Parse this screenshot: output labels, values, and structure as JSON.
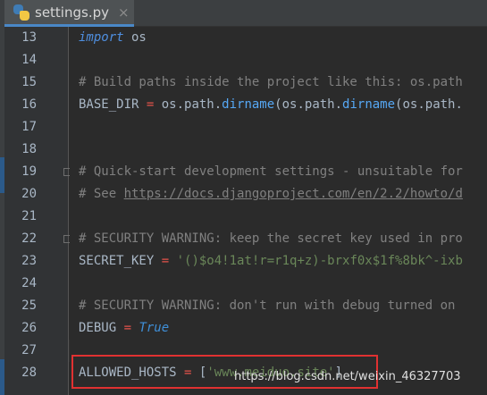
{
  "tab": {
    "filename": "settings.py",
    "close_glyph": "×",
    "icon": "python-file-icon"
  },
  "lines": [
    {
      "num": "13",
      "tokens": [
        {
          "t": "import",
          "c": "kw-imp"
        },
        {
          "t": " os",
          "c": "plain"
        }
      ]
    },
    {
      "num": "14",
      "tokens": []
    },
    {
      "num": "15",
      "tokens": [
        {
          "t": "# Build paths inside the project like this: os.path",
          "c": "cmt"
        }
      ]
    },
    {
      "num": "16",
      "tokens": [
        {
          "t": "BASE_DIR ",
          "c": "plain"
        },
        {
          "t": "=",
          "c": "op"
        },
        {
          "t": " os.path.",
          "c": "plain"
        },
        {
          "t": "dirname",
          "c": "call"
        },
        {
          "t": "(os.path.",
          "c": "plain"
        },
        {
          "t": "dirname",
          "c": "call"
        },
        {
          "t": "(os.path.",
          "c": "plain"
        }
      ]
    },
    {
      "num": "17",
      "tokens": []
    },
    {
      "num": "18",
      "tokens": []
    },
    {
      "num": "19",
      "tokens": [
        {
          "t": "# Quick-start development settings - unsuitable for",
          "c": "cmt"
        }
      ]
    },
    {
      "num": "20",
      "tokens": [
        {
          "t": "# See ",
          "c": "cmt"
        },
        {
          "t": "https://docs.djangoproject.com/en/2.2/howto/d",
          "c": "cmt-link"
        }
      ]
    },
    {
      "num": "21",
      "tokens": []
    },
    {
      "num": "22",
      "tokens": [
        {
          "t": "# SECURITY WARNING: keep the secret key used in pro",
          "c": "cmt"
        }
      ]
    },
    {
      "num": "23",
      "tokens": [
        {
          "t": "SECRET_KEY ",
          "c": "plain"
        },
        {
          "t": "=",
          "c": "op"
        },
        {
          "t": " ",
          "c": "plain"
        },
        {
          "t": "'()$o4!1at!r=r1q+z)-brxf0x$1f%8bk^-ixb",
          "c": "str"
        }
      ]
    },
    {
      "num": "24",
      "tokens": []
    },
    {
      "num": "25",
      "tokens": [
        {
          "t": "# SECURITY WARNING: don't run with debug turned on",
          "c": "cmt"
        }
      ]
    },
    {
      "num": "26",
      "tokens": [
        {
          "t": "DEBUG ",
          "c": "plain"
        },
        {
          "t": "=",
          "c": "op"
        },
        {
          "t": " ",
          "c": "plain"
        },
        {
          "t": "True",
          "c": "const"
        }
      ]
    },
    {
      "num": "27",
      "tokens": []
    },
    {
      "num": "28",
      "tokens": [
        {
          "t": "ALLOWED_HOSTS ",
          "c": "plain"
        },
        {
          "t": "=",
          "c": "op"
        },
        {
          "t": " [",
          "c": "plain"
        },
        {
          "t": "'www.meiduo.site'",
          "c": "str"
        },
        {
          "t": "]",
          "c": "plain"
        }
      ]
    }
  ],
  "current_line": "27",
  "highlighted_line": "28",
  "watermark": "https://blog.csdn.net/weixin_46327703"
}
